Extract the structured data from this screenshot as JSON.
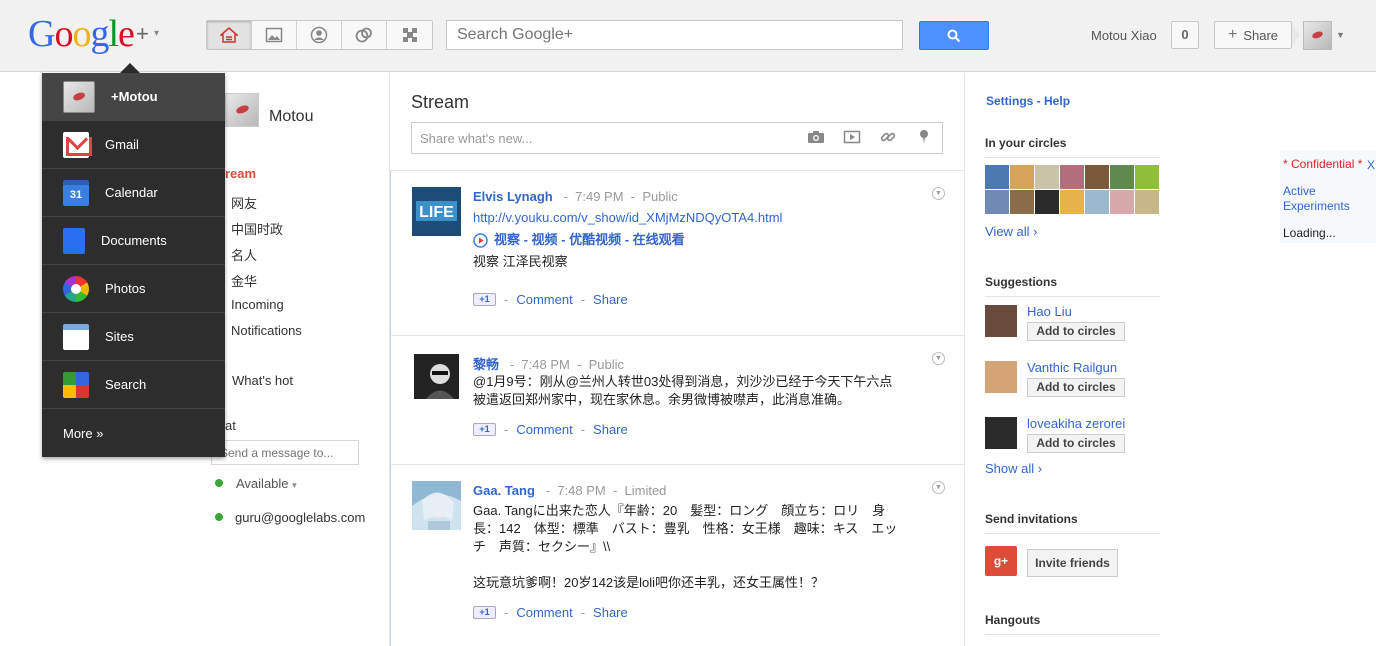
{
  "topbar": {
    "logo": {
      "g1": "G",
      "o1": "o",
      "o2": "o",
      "g2": "g",
      "l": "l",
      "e": "e",
      "plus": "+",
      "dropdown": "▾"
    },
    "search_placeholder": "Search Google+",
    "username": "Motou Xiao",
    "notification_count": "0",
    "share_label": "Share",
    "share_plus": "+"
  },
  "app_menu": {
    "items": [
      {
        "label": "+Motou",
        "icon": "profile-avatar"
      },
      {
        "label": "Gmail",
        "icon": "gmail-icon"
      },
      {
        "label": "Calendar",
        "icon": "calendar-icon",
        "badge": "31"
      },
      {
        "label": "Documents",
        "icon": "documents-icon"
      },
      {
        "label": "Photos",
        "icon": "photos-icon"
      },
      {
        "label": "Sites",
        "icon": "sites-icon"
      },
      {
        "label": "Search",
        "icon": "search-icon"
      }
    ],
    "more_label": "More »"
  },
  "left": {
    "profile_name": "Motou",
    "nav": [
      "ream",
      "网友",
      "中国时政",
      "名人",
      "金华",
      "Incoming",
      "Notifications"
    ],
    "whats_hot": "What's hot",
    "chat_label": "at",
    "chat_placeholder": "Send a message to...",
    "status": "Available",
    "status_caret": "▾",
    "contact": "guru@googlelabs.com"
  },
  "main": {
    "title": "Stream",
    "share_placeholder": "Share what's new...",
    "posts": [
      {
        "author": "Elvis Lynagh",
        "time": "7:49 PM",
        "visibility": "Public",
        "link": "http://v.youku.com/v_show/id_XMjMzNDQyOTA4.html",
        "link_title": "视察 - 视频 - 优酷视频 - 在线观看",
        "text": "视察 江泽民视察"
      },
      {
        "author": "黎畅",
        "time": "7:48 PM",
        "visibility": "Public",
        "text1": "@1月9号：刚从@兰州人转世03处得到消息，刘沙沙已经于今天下午六点",
        "text2": "被遣返回郑州家中，现在家休息。余男微博被噤声，此消息准确。"
      },
      {
        "author": "Gaa. Tang",
        "time": "7:48 PM",
        "visibility": "Limited",
        "text1": "Gaa. Tangに出来た恋人『年齢：20　髪型：ロング　顔立ち：ロリ　身",
        "text2": "長：142　体型：標準　バスト：豊乳　性格：女王様　趣味：キス　エッ",
        "text3": "チ　声質：セクシー』\\\\",
        "text4": "这玩意坑爹啊！20岁142该是loli吧你还丰乳，还女王属性！？"
      }
    ],
    "plus1": "+1",
    "comment": "Comment",
    "share": "Share",
    "sep": "-"
  },
  "right": {
    "settings": "Settings",
    "help": "Help",
    "settings_sep": " - ",
    "in_circles": "In your circles",
    "view_all": "View all ›",
    "suggestions": "Suggestions",
    "people": [
      {
        "name": "Hao Liu",
        "button": "Add to circles"
      },
      {
        "name": "Vanthic Railgun",
        "button": "Add to circles"
      },
      {
        "name": "loveakiha zerorei",
        "button": "Add to circles"
      }
    ],
    "show_all": "Show all ›",
    "send_invitations": "Send invitations",
    "invite_friends": "Invite friends",
    "invite_icon_text": "g+",
    "hangouts": "Hangouts"
  },
  "confidential": {
    "label": "* Confidential *",
    "close": "X",
    "active_experiments": "Active Experiments",
    "loading": "Loading..."
  },
  "colors": {
    "accent": "#3366cc",
    "brand_red": "#dd4b39",
    "search_button": "#4d90fe",
    "menu_bg": "#2d2d2d"
  }
}
